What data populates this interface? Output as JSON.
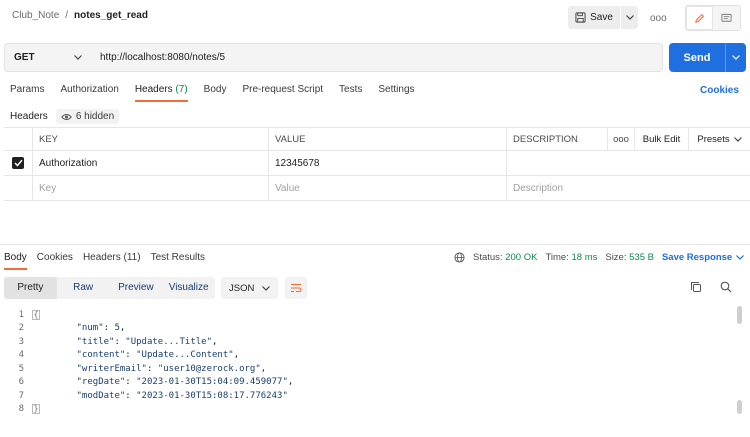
{
  "header": {
    "breadcrumb_parent": "Club_Note",
    "breadcrumb_sep": "/",
    "breadcrumb_current": "notes_get_read",
    "save_label": "Save",
    "more": "ooo"
  },
  "request": {
    "method": "GET",
    "url": "http://localhost:8080/notes/5",
    "send_label": "Send"
  },
  "req_tabs": {
    "params": "Params",
    "authorization": "Authorization",
    "headers": "Headers",
    "headers_count": "(7)",
    "body": "Body",
    "prereq": "Pre-request Script",
    "tests": "Tests",
    "settings": "Settings",
    "cookies": "Cookies"
  },
  "headers_section": {
    "title": "Headers",
    "hidden": "6 hidden"
  },
  "table": {
    "col_key": "KEY",
    "col_value": "VALUE",
    "col_desc": "DESCRIPTION",
    "col_more": "ooo",
    "bulk_edit": "Bulk Edit",
    "presets": "Presets",
    "rows": [
      {
        "key": "Authorization",
        "value": "12345678",
        "desc": ""
      }
    ],
    "placeholder_key": "Key",
    "placeholder_value": "Value",
    "placeholder_desc": "Description"
  },
  "resp_tabs": {
    "body": "Body",
    "cookies": "Cookies",
    "headers": "Headers (11)",
    "tests": "Test Results"
  },
  "status": {
    "status_label": "Status:",
    "status_value": "200 OK",
    "time_label": "Time:",
    "time_value": "18 ms",
    "size_label": "Size:",
    "size_value": "535 B",
    "save_response": "Save Response"
  },
  "view": {
    "pretty": "Pretty",
    "raw": "Raw",
    "preview": "Preview",
    "visualize": "Visualize",
    "format": "JSON"
  },
  "code": {
    "l1": "{",
    "num_key": "\"num\"",
    "num_val": "5",
    "title_key": "\"title\"",
    "title_val": "\"Update...Title\"",
    "content_key": "\"content\"",
    "content_val": "\"Update...Content\"",
    "email_key": "\"writerEmail\"",
    "email_val": "\"user10@zerock.org\"",
    "reg_key": "\"regDate\"",
    "reg_val": "\"2023-01-30T15:04:09.459077\"",
    "mod_key": "\"modDate\"",
    "mod_val": "\"2023-01-30T15:08:17.776243\"",
    "l8": "}"
  },
  "colors": {
    "accent": "#f26b3a",
    "send": "#1f6fe0",
    "ok": "#0c8a4b"
  }
}
